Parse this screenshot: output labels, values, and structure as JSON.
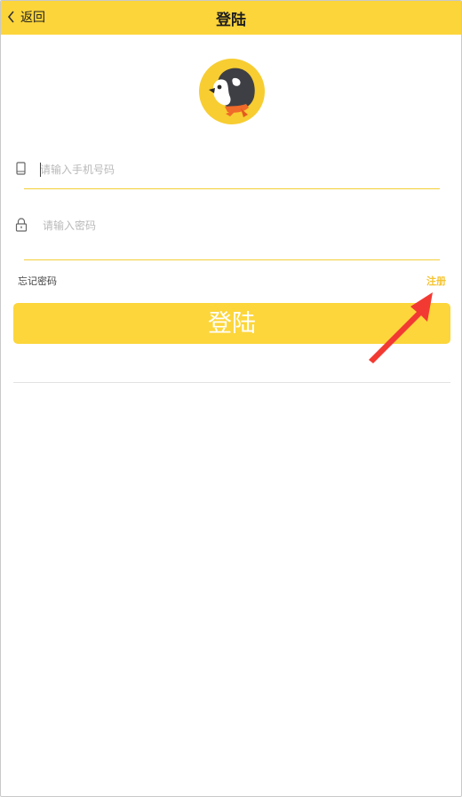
{
  "header": {
    "back_label": "返回",
    "title": "登陆",
    "background": "#fcd53a"
  },
  "logo": {
    "icon": "penguin-mascot-logo"
  },
  "form": {
    "phone": {
      "icon": "phone-icon",
      "placeholder": "请输入手机号码",
      "value": ""
    },
    "password": {
      "icon": "lock-icon",
      "placeholder": "请输入密码",
      "value": ""
    },
    "forgot_label": "忘记密码",
    "register_label": "注册",
    "submit_label": "登陆"
  },
  "annotation": {
    "icon": "red-arrow-icon",
    "color": "#f23a33"
  },
  "colors": {
    "accent": "#fcd63b",
    "register_text": "#f5c431"
  }
}
